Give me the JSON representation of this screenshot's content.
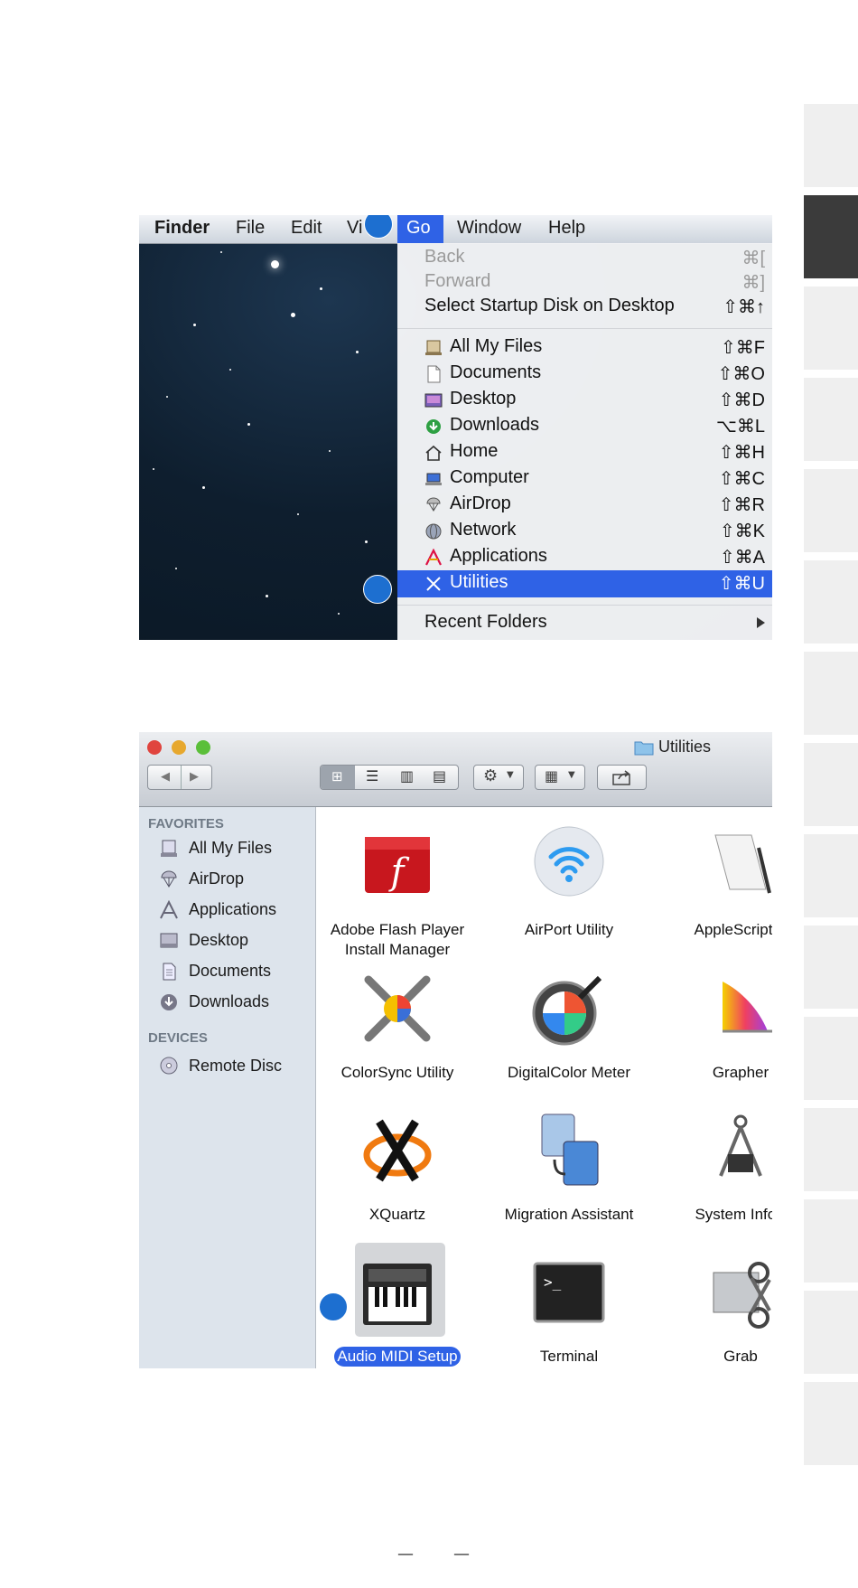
{
  "menubar": {
    "items": [
      "Finder",
      "File",
      "Edit",
      "Vi",
      "Go",
      "Window",
      "Help"
    ]
  },
  "go_menu": {
    "items": [
      {
        "label": "Back",
        "shortcut": "⌘[",
        "disabled": true
      },
      {
        "label": "Forward",
        "shortcut": "⌘]",
        "disabled": true
      },
      {
        "label": "Select Startup Disk on Desktop",
        "shortcut": "⇧⌘↑"
      },
      {
        "label": "All My Files",
        "shortcut": "⇧⌘F",
        "icon": "all-my-files-icon"
      },
      {
        "label": "Documents",
        "shortcut": "⇧⌘O",
        "icon": "documents-icon"
      },
      {
        "label": "Desktop",
        "shortcut": "⇧⌘D",
        "icon": "desktop-icon"
      },
      {
        "label": "Downloads",
        "shortcut": "⌥⌘L",
        "icon": "downloads-icon"
      },
      {
        "label": "Home",
        "shortcut": "⇧⌘H",
        "icon": "home-icon"
      },
      {
        "label": "Computer",
        "shortcut": "⇧⌘C",
        "icon": "computer-icon"
      },
      {
        "label": "AirDrop",
        "shortcut": "⇧⌘R",
        "icon": "airdrop-icon"
      },
      {
        "label": "Network",
        "shortcut": "⇧⌘K",
        "icon": "network-icon"
      },
      {
        "label": "Applications",
        "shortcut": "⇧⌘A",
        "icon": "applications-icon"
      },
      {
        "label": "Utilities",
        "shortcut": "⇧⌘U",
        "icon": "utilities-icon",
        "selected": true
      },
      {
        "label": "Recent Folders",
        "submenu": true
      }
    ]
  },
  "finder": {
    "title": "Utilities",
    "sidebar": {
      "favorites_heading": "FAVORITES",
      "favorites": [
        "All My Files",
        "AirDrop",
        "Applications",
        "Desktop",
        "Documents",
        "Downloads"
      ],
      "devices_heading": "DEVICES",
      "devices": [
        "Remote Disc"
      ]
    },
    "apps": [
      {
        "name": "Adobe Flash Player\nInstall Manager",
        "icon": "adobe-flash-icon"
      },
      {
        "name": "AirPort Utility",
        "icon": "airport-utility-icon"
      },
      {
        "name": "AppleScript E",
        "icon": "applescript-icon"
      },
      {
        "name": "ColorSync Utility",
        "icon": "colorsync-icon"
      },
      {
        "name": "DigitalColor Meter",
        "icon": "digitalcolor-meter-icon"
      },
      {
        "name": "Grapher",
        "icon": "grapher-icon"
      },
      {
        "name": "XQuartz",
        "icon": "xquartz-icon"
      },
      {
        "name": "Migration Assistant",
        "icon": "migration-assistant-icon"
      },
      {
        "name": "System Inforr",
        "icon": "system-information-icon"
      },
      {
        "name": "Audio MIDI Setup",
        "icon": "audio-midi-setup-icon",
        "selected": true
      },
      {
        "name": "Terminal",
        "icon": "terminal-icon"
      },
      {
        "name": "Grab",
        "icon": "grab-icon"
      }
    ]
  },
  "colors": {
    "selection": "#2f62e6",
    "callout": "#1d6fd0",
    "sidebar_bg": "#dde4ec"
  },
  "footer": {
    "dash_left": "—",
    "dash_right": "—"
  }
}
